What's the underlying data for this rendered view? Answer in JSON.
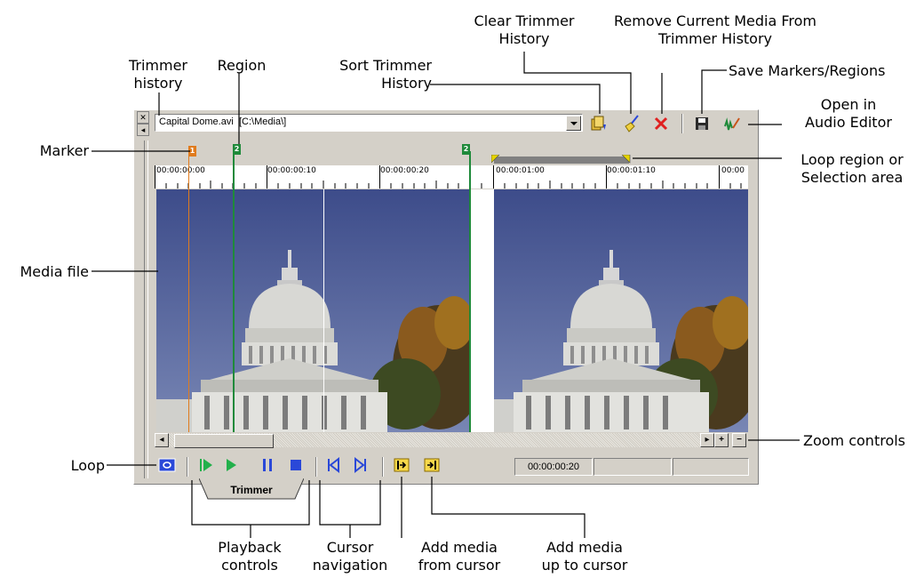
{
  "callouts": {
    "trimmer_history": "Trimmer\nhistory",
    "region": "Region",
    "sort_trimmer_history": "Sort Trimmer\nHistory",
    "clear_trimmer_history": "Clear Trimmer\nHistory",
    "remove_current_media": "Remove Current Media From\nTrimmer History",
    "save_markers_regions": "Save Markers/Regions",
    "open_in_audio_editor": "Open in\nAudio Editor",
    "marker": "Marker",
    "loop_region": "Loop region or\nSelection area",
    "media_file": "Media file",
    "zoom_controls": "Zoom controls",
    "loop": "Loop",
    "playback_controls": "Playback\ncontrols",
    "cursor_navigation": "Cursor\nnavigation",
    "add_media_from_cursor": "Add media\nfrom cursor",
    "add_media_up_to_cursor": "Add media\nup to cursor"
  },
  "trimmer": {
    "file_name": "Capital Dome.avi",
    "file_path": "[C:\\Media\\]",
    "tab_label": "Trimmer",
    "marker_labels": [
      "1",
      "2",
      "2"
    ],
    "ruler_ticks": [
      "00:00:00:00",
      "00:00:00:10",
      "00:00:00:20",
      "00:00:01:00",
      "00:00:01:10",
      "00:00"
    ],
    "cursor_time": "00:00:00:20",
    "zoom_in_label": "+",
    "zoom_out_label": "−"
  },
  "colors": {
    "panel": "#d4d0c8",
    "marker": "#e07b1d",
    "region": "#1f8a3a",
    "play": "#22b04b",
    "pause_stop": "#2a48d8",
    "loop_handle": "#e6d400",
    "remove_red": "#e02020"
  },
  "icons": [
    "sort-icon",
    "clear-broom-icon",
    "remove-x-icon",
    "save-disk-icon",
    "audio-editor-icon",
    "loop-icon",
    "play-from-start-icon",
    "play-icon",
    "pause-icon",
    "stop-icon",
    "go-to-start-icon",
    "go-to-end-icon",
    "add-from-cursor-icon",
    "add-up-to-cursor-icon"
  ]
}
